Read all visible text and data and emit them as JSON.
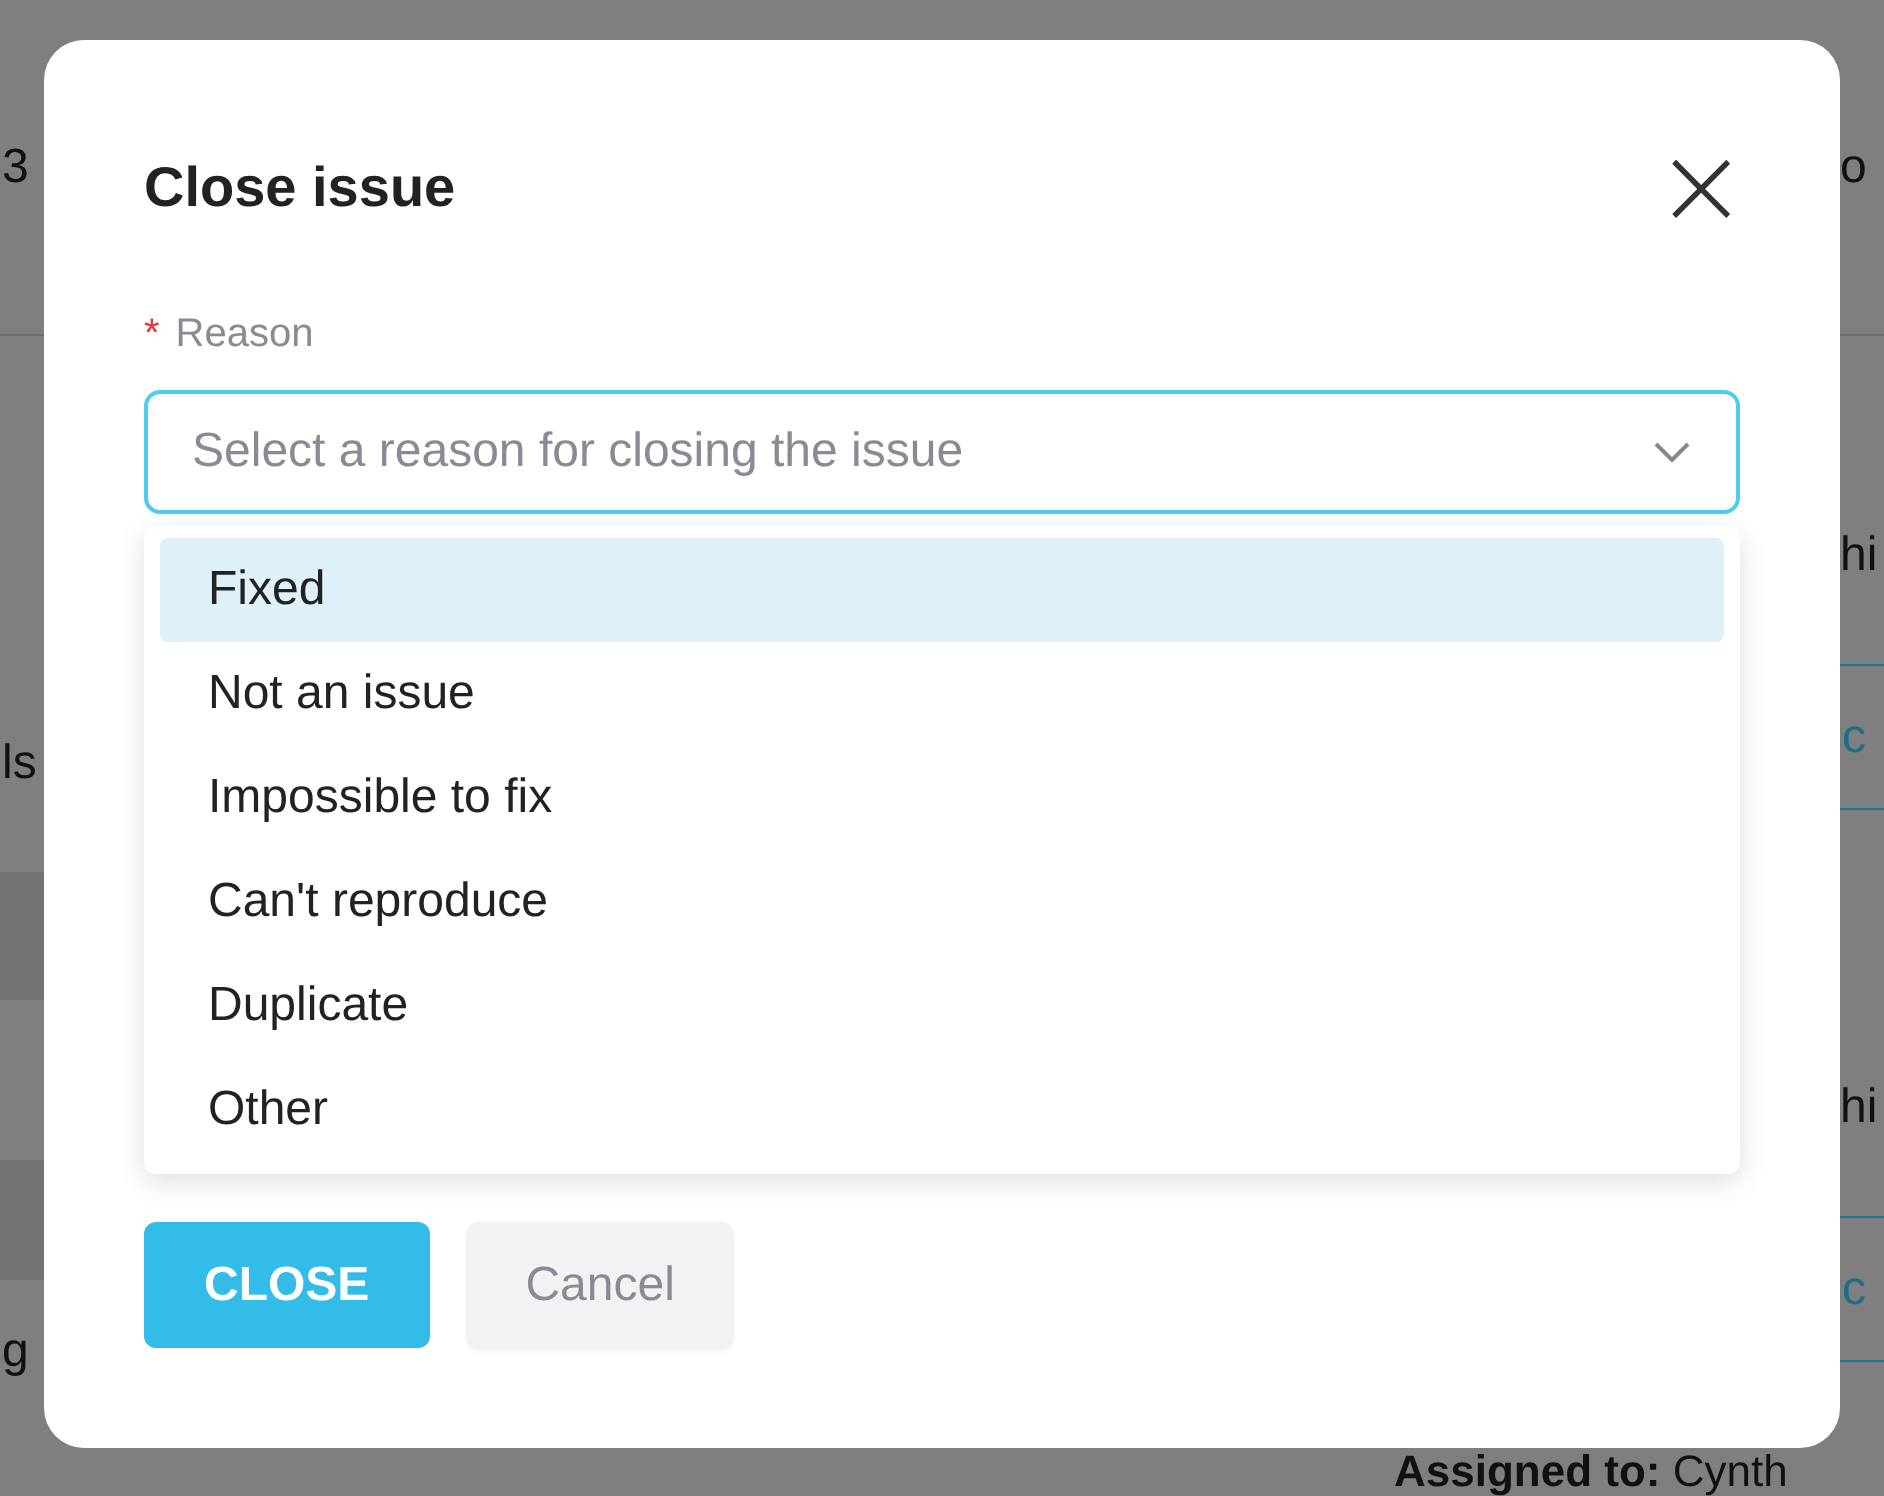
{
  "background": {
    "left": [
      {
        "kind": "header",
        "text": "3"
      },
      {
        "kind": "row",
        "text": "ls"
      },
      {
        "kind": "band"
      },
      {
        "kind": "row"
      },
      {
        "kind": "band"
      },
      {
        "kind": "row",
        "text": "g"
      }
    ],
    "right": [
      {
        "kind": "header",
        "text": "o"
      },
      {
        "kind": "row",
        "text": "hi"
      },
      {
        "kind": "button",
        "text": "c"
      },
      {
        "kind": "row",
        "text": "hi"
      },
      {
        "kind": "button",
        "text": "c"
      }
    ],
    "footer": {
      "right": "**Assigned to:** Cynth"
    }
  },
  "dialog": {
    "title": "Close issue",
    "close_icon": "×",
    "field": {
      "label": "Reason",
      "required_mark": "*",
      "placeholder": "Select a reason for closing the issue",
      "expanded": true
    },
    "options": [
      {
        "label": "Fixed",
        "selected": true
      },
      {
        "label": "Not an issue",
        "selected": false
      },
      {
        "label": "Impossible to fix",
        "selected": false
      },
      {
        "label": "Can't reproduce",
        "selected": false
      },
      {
        "label": "Duplicate",
        "selected": false
      },
      {
        "label": "Other",
        "selected": false
      }
    ],
    "buttons": [
      {
        "kind": "primary",
        "label": "CLOSE"
      },
      {
        "kind": "secondary",
        "label": "Cancel"
      }
    ]
  }
}
